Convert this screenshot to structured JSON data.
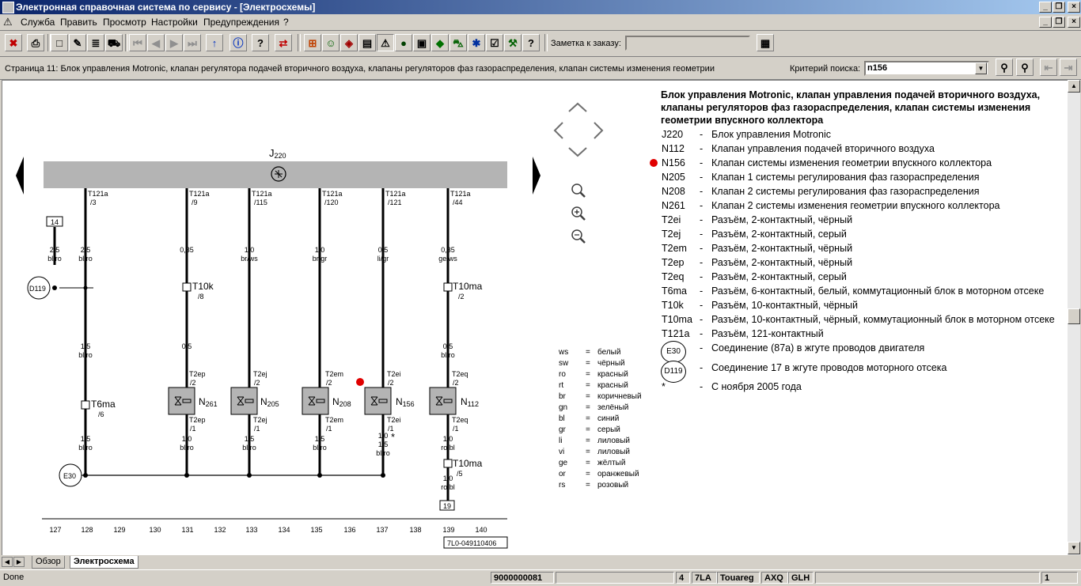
{
  "window": {
    "title": "Электронная справочная система по сервису - [Электросхемы]"
  },
  "menu": [
    "Служба",
    "Править",
    "Просмотр",
    "Настройки",
    "Предупреждения",
    "?"
  ],
  "toolbar": {
    "order_note_label": "Заметка к заказу:",
    "order_note_value": ""
  },
  "page": {
    "header": "Страница 11: Блок управления Motronic, клапан регулятора подачей вторичного воздуха, клапаны регуляторов фаз газораспределения, клапан системы изменения геометрии",
    "search_label": "Критерий поиска:",
    "search_value": "n156"
  },
  "legend": {
    "title": "Блок управления Motronic, клапан управления подачей вторичного воздуха, клапаны регуляторов фаз газораспределения, клапан системы изменения геометрии впускного коллектора",
    "items": [
      {
        "code": "J220",
        "desc": "Блок управления Motronic"
      },
      {
        "code": "N112",
        "desc": "Клапан управления подачей вторичного воздуха"
      },
      {
        "code": "N156",
        "desc": "Клапан системы изменения геометрии впускного коллектора"
      },
      {
        "code": "N205",
        "desc": "Клапан 1 системы регулирования фаз газораспределения"
      },
      {
        "code": "N208",
        "desc": "Клапан 2 системы регулирования фаз газораспределения"
      },
      {
        "code": "N261",
        "desc": "Клапан 2 системы изменения геометрии впускного коллектора"
      },
      {
        "code": "T2ei",
        "desc": "Разъём, 2-контактный, чёрный"
      },
      {
        "code": "T2ej",
        "desc": "Разъём, 2-контактный, серый"
      },
      {
        "code": "T2em",
        "desc": "Разъём, 2-контактный, чёрный"
      },
      {
        "code": "T2ep",
        "desc": "Разъём, 2-контактный, чёрный"
      },
      {
        "code": "T2eq",
        "desc": "Разъём, 2-контактный, серый"
      },
      {
        "code": "T6ma",
        "desc": "Разъём, 6-контактный, белый, коммутационный блок в моторном отсеке"
      },
      {
        "code": "T10k",
        "desc": "Разъём, 10-контактный, чёрный"
      },
      {
        "code": "T10ma",
        "desc": "Разъём, 10-контактный, чёрный, коммутационный блок в моторном отсеке"
      },
      {
        "code": "T121a",
        "desc": "Разъём, 121-контактный"
      }
    ],
    "connections": [
      {
        "code": "E30",
        "desc": "Соединение (87a) в жгуте проводов двигателя"
      },
      {
        "code": "D119",
        "desc": "Соединение 17 в жгуте проводов моторного отсека"
      }
    ],
    "star_note": {
      "code": "*",
      "desc": "С ноября 2005 года"
    }
  },
  "colors": [
    {
      "code": "ws",
      "name": "белый"
    },
    {
      "code": "sw",
      "name": "чёрный"
    },
    {
      "code": "ro",
      "name": "красный"
    },
    {
      "code": "rt",
      "name": "красный"
    },
    {
      "code": "br",
      "name": "коричневый"
    },
    {
      "code": "gn",
      "name": "зелёный"
    },
    {
      "code": "bl",
      "name": "синий"
    },
    {
      "code": "gr",
      "name": "серый"
    },
    {
      "code": "li",
      "name": "лиловый"
    },
    {
      "code": "vi",
      "name": "лиловый"
    },
    {
      "code": "ge",
      "name": "жёлтый"
    },
    {
      "code": "or",
      "name": "оранжевый"
    },
    {
      "code": "rs",
      "name": "розовый"
    }
  ],
  "diagram": {
    "unit_label": "J",
    "unit_sub": "220",
    "doc_number": "7L0-049110406",
    "page_numbers": [
      "127",
      "128",
      "129",
      "130",
      "131",
      "132",
      "133",
      "134",
      "135",
      "136",
      "137",
      "138",
      "139",
      "140"
    ],
    "wires": [
      {
        "pin": "T121a",
        "pin_no": "/3",
        "size": "2,5",
        "color": "bl/ro",
        "size2": "1,5",
        "color2": "bl/ro",
        "size3": "1,5",
        "color3": "bl/ro"
      },
      {
        "pin": "T121a",
        "pin_no": "/9",
        "size": "0,35",
        "color": "li",
        "conn": "T10k",
        "conn_pin": "/8",
        "size2": "0,5",
        "color2": "li",
        "top_conn": "T2ep",
        "top_pin": "/2",
        "comp": "N",
        "comp_sub": "261",
        "bot_conn": "T2ep",
        "bot_pin": "/1",
        "size3": "1,0",
        "color3": "bl/ro"
      },
      {
        "pin": "T121a",
        "pin_no": "/115",
        "size": "1,0",
        "color": "br/ws",
        "top_conn": "T2ej",
        "top_pin": "/2",
        "comp": "N",
        "comp_sub": "205",
        "bot_conn": "T2ej",
        "bot_pin": "/1",
        "size3": "1,5",
        "color3": "bl/ro"
      },
      {
        "pin": "T121a",
        "pin_no": "/120",
        "size": "1,0",
        "color": "br/gr",
        "top_conn": "T2em",
        "top_pin": "/2",
        "comp": "N",
        "comp_sub": "208",
        "bot_conn": "T2em",
        "bot_pin": "/1",
        "size3": "1,5",
        "color3": "bl/ro"
      },
      {
        "pin": "T121a",
        "pin_no": "/121",
        "size": "0,5",
        "color": "li/gr",
        "top_conn": "T2ei",
        "top_pin": "/2",
        "comp": "N",
        "comp_sub": "156",
        "bot_conn": "T2ei",
        "bot_pin": "/1",
        "size3": "1,0",
        "size3b": "1,5",
        "color3": "bl/ro"
      },
      {
        "pin": "T121a",
        "pin_no": "/44",
        "size": "0,35",
        "color": "ge/ws",
        "conn": "T10ma",
        "conn_pin": "/2",
        "size2": "0,5",
        "color2": "bl/ro",
        "top_conn": "T2eq",
        "top_pin": "/2",
        "comp": "N",
        "comp_sub": "112",
        "bot_conn": "T2eq",
        "bot_pin": "/1",
        "size3": "1,0",
        "color3": "ro/bl",
        "conn4": "T10ma",
        "conn4_pin": "/5",
        "size4": "1,0",
        "color4": "ro/bl"
      }
    ],
    "box14": "14",
    "box19": "19",
    "conn6": "T6ma",
    "conn6_pin": "/6",
    "star": "*",
    "e30": "E30",
    "d119": "D119"
  },
  "tabs": {
    "overview": "Обзор",
    "scheme": "Электросхема"
  },
  "status": {
    "left": "Done",
    "id": "9000000081",
    "f1": "4",
    "f2": "7LA",
    "f3": "Touareg",
    "f4": "AXQ",
    "f5": "GLH",
    "f6": "1"
  }
}
